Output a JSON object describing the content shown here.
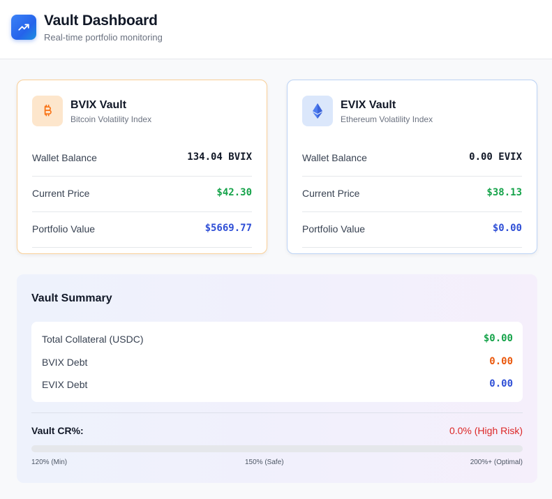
{
  "header": {
    "title": "Vault Dashboard",
    "subtitle": "Real-time portfolio monitoring"
  },
  "vaults": [
    {
      "name": "BVIX Vault",
      "description": "Bitcoin Volatility Index",
      "icon": "bitcoin-icon",
      "accent": "#f9cf97",
      "rows": [
        {
          "label": "Wallet Balance",
          "value": "134.04 BVIX"
        },
        {
          "label": "Current Price",
          "value": "$42.30"
        },
        {
          "label": "Portfolio Value",
          "value": "$5669.77"
        }
      ]
    },
    {
      "name": "EVIX Vault",
      "description": "Ethereum Volatility Index",
      "icon": "ethereum-icon",
      "accent": "#bcd3f5",
      "rows": [
        {
          "label": "Wallet Balance",
          "value": "0.00 EVIX"
        },
        {
          "label": "Current Price",
          "value": "$38.13"
        },
        {
          "label": "Portfolio Value",
          "value": "$0.00"
        }
      ]
    }
  ],
  "summary": {
    "title": "Vault Summary",
    "rows": [
      {
        "label": "Total Collateral (USDC)",
        "value": "$0.00"
      },
      {
        "label": "BVIX Debt",
        "value": "0.00"
      },
      {
        "label": "EVIX Debt",
        "value": "0.00"
      }
    ],
    "cr_label": "Vault CR%:",
    "cr_value": "0.0% (High Risk)",
    "cr_progress": 0,
    "ticks": [
      "120% (Min)",
      "150% (Safe)",
      "200%+ (Optimal)"
    ]
  },
  "colors": {
    "positive": "#16a34a",
    "value_blue": "#2f4fd6",
    "debt_orange": "#ea580c",
    "risk_red": "#dc2626"
  }
}
